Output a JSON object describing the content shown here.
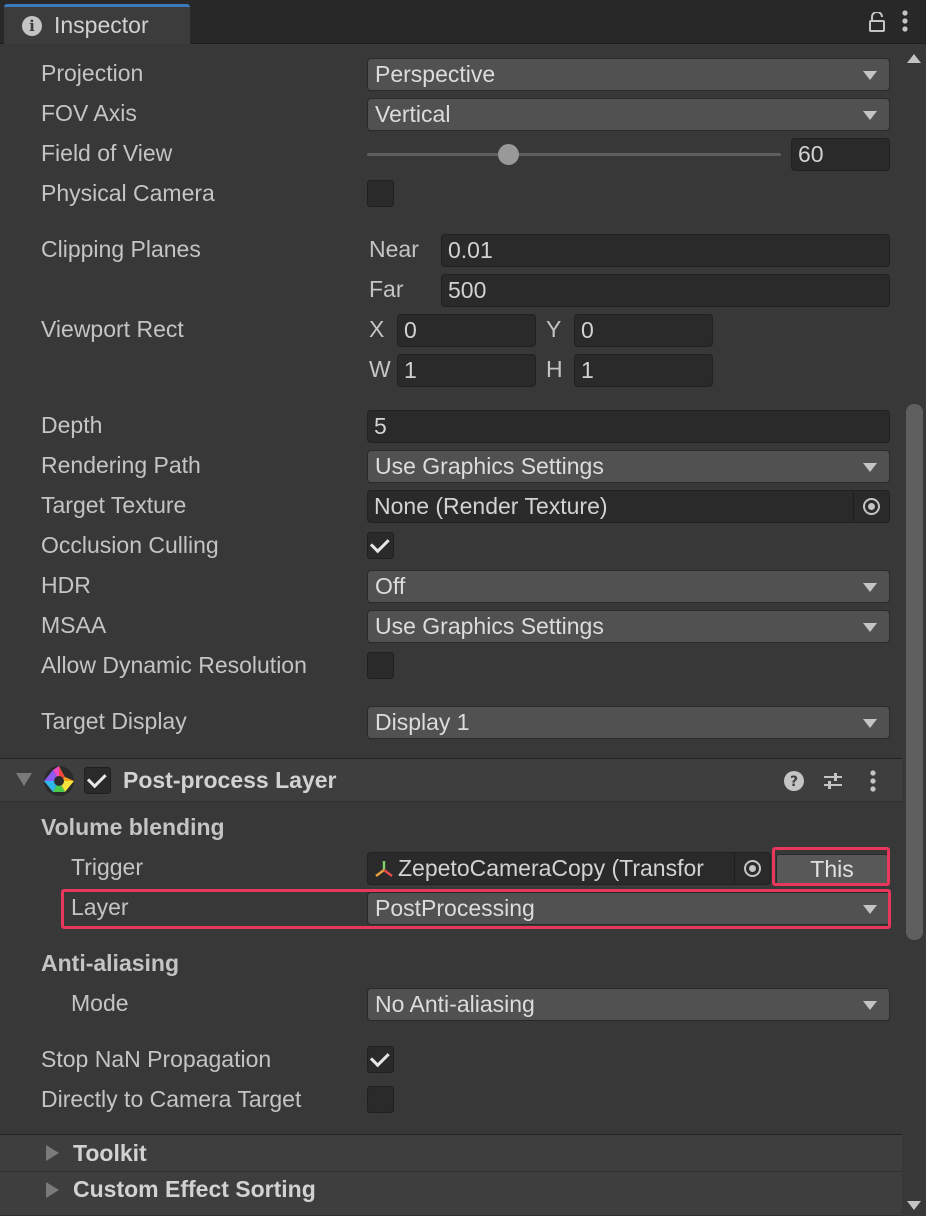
{
  "window": {
    "tab_title": "Inspector"
  },
  "camera": {
    "projection": {
      "label": "Projection",
      "value": "Perspective"
    },
    "fov_axis": {
      "label": "FOV Axis",
      "value": "Vertical"
    },
    "field_of_view": {
      "label": "Field of View",
      "value": "60",
      "slider_fraction": 0.33
    },
    "physical_camera": {
      "label": "Physical Camera",
      "checked": false
    },
    "clipping_planes": {
      "label": "Clipping Planes",
      "near_label": "Near",
      "near": "0.01",
      "far_label": "Far",
      "far": "500"
    },
    "viewport_rect": {
      "label": "Viewport Rect",
      "x_label": "X",
      "x": "0",
      "y_label": "Y",
      "y": "0",
      "w_label": "W",
      "w": "1",
      "h_label": "H",
      "h": "1"
    },
    "depth": {
      "label": "Depth",
      "value": "5"
    },
    "rendering_path": {
      "label": "Rendering Path",
      "value": "Use Graphics Settings"
    },
    "target_texture": {
      "label": "Target Texture",
      "value": "None (Render Texture)"
    },
    "occlusion_culling": {
      "label": "Occlusion Culling",
      "checked": true
    },
    "hdr": {
      "label": "HDR",
      "value": "Off"
    },
    "msaa": {
      "label": "MSAA",
      "value": "Use Graphics Settings"
    },
    "allow_dynamic_resolution": {
      "label": "Allow Dynamic Resolution",
      "checked": false
    },
    "target_display": {
      "label": "Target Display",
      "value": "Display 1"
    }
  },
  "post_process_layer": {
    "title": "Post-process Layer",
    "enabled": true,
    "volume_blending": {
      "heading": "Volume blending",
      "trigger": {
        "label": "Trigger",
        "value": "ZepetoCameraCopy (Transfor",
        "this_button": "This"
      },
      "layer": {
        "label": "Layer",
        "value": "PostProcessing"
      }
    },
    "anti_aliasing": {
      "heading": "Anti-aliasing",
      "mode": {
        "label": "Mode",
        "value": "No Anti-aliasing"
      }
    },
    "stop_nan": {
      "label": "Stop NaN Propagation",
      "checked": true
    },
    "direct_to_camera": {
      "label": "Directly to Camera Target",
      "checked": false
    },
    "toolkit": {
      "title": "Toolkit"
    },
    "custom_effect_sorting": {
      "title": "Custom Effect Sorting"
    }
  },
  "colors": {
    "highlight": "#e8375a",
    "tab_accent": "#3a79bb",
    "panel_bg": "#383838"
  }
}
